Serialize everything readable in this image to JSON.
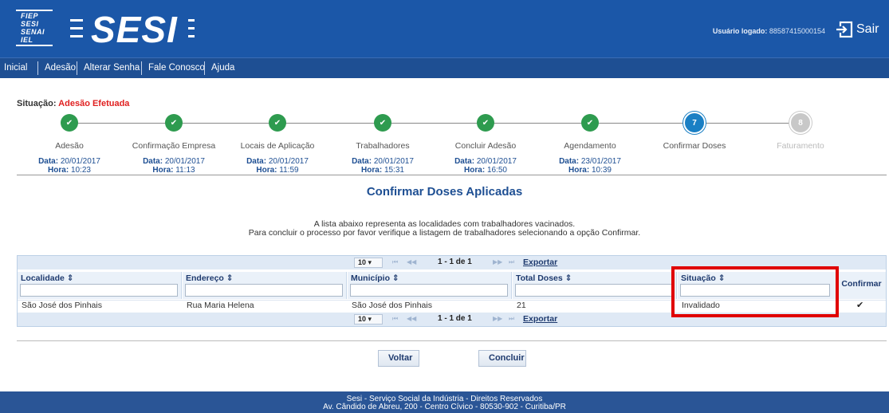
{
  "header": {
    "logo_small_lines": [
      "FIEP",
      "SESI",
      "SENAI",
      "IEL"
    ],
    "logo_word": "SESI",
    "user_label": "Usuário logado:",
    "user_id": "88587415000154",
    "logout_label": "Sair"
  },
  "nav": {
    "items": [
      "Inicial",
      "Adesão",
      "Alterar Senha",
      "Fale Conosco",
      "Ajuda"
    ]
  },
  "status": {
    "label": "Situação:",
    "value": "Adesão Efetuada"
  },
  "steps": [
    {
      "label": "Adesão",
      "date_label": "Data:",
      "date": "20/01/2017",
      "time_label": "Hora:",
      "time": "10:23",
      "state": "done"
    },
    {
      "label": "Confirmação Empresa",
      "date_label": "Data:",
      "date": "20/01/2017",
      "time_label": "Hora:",
      "time": "11:13",
      "state": "done"
    },
    {
      "label": "Locais de Aplicação",
      "date_label": "Data:",
      "date": "20/01/2017",
      "time_label": "Hora:",
      "time": "11:59",
      "state": "done"
    },
    {
      "label": "Trabalhadores",
      "date_label": "Data:",
      "date": "20/01/2017",
      "time_label": "Hora:",
      "time": "15:31",
      "state": "done"
    },
    {
      "label": "Concluir Adesão",
      "date_label": "Data:",
      "date": "20/01/2017",
      "time_label": "Hora:",
      "time": "16:50",
      "state": "done"
    },
    {
      "label": "Agendamento",
      "date_label": "Data:",
      "date": "23/01/2017",
      "time_label": "Hora:",
      "time": "10:39",
      "state": "done"
    },
    {
      "label": "Confirmar Doses",
      "number": "7",
      "state": "current"
    },
    {
      "label": "Faturamento",
      "number": "8",
      "state": "future"
    }
  ],
  "page_title": "Confirmar Doses Aplicadas",
  "description": [
    "A lista abaixo representa as localidades com trabalhadores vacinados.",
    "Para concluir o processo por favor verifique a listagem de trabalhadores selecionando a opção Confirmar."
  ],
  "table": {
    "page_size": "10",
    "page_info": "1 - 1 de 1",
    "export_label": "Exportar",
    "columns": [
      "Localidade",
      "Endereço",
      "Município",
      "Total Doses",
      "Situação"
    ],
    "confirm_header": "Confirmar",
    "rows": [
      {
        "cells": [
          "São José dos Pinhais",
          "Rua Maria Helena",
          "São José dos Pinhais",
          "21",
          "Invalidado"
        ],
        "confirm_icon": "✔"
      }
    ]
  },
  "buttons": {
    "back": "Voltar",
    "finish": "Concluir"
  },
  "footer": {
    "line1": "Sesi - Serviço Social da Indústria - Direitos Reservados",
    "line2": "Av. Cândido de Abreu, 200 - Centro Cívico - 80530-902 - Curitiba/PR"
  },
  "colors": {
    "header_blue": "#1b57a8",
    "nav_blue": "#1e4f93",
    "done_green": "#2e9b4f",
    "current_blue": "#1a7fc4",
    "status_red": "#e02020",
    "highlight_red": "#e00000"
  }
}
